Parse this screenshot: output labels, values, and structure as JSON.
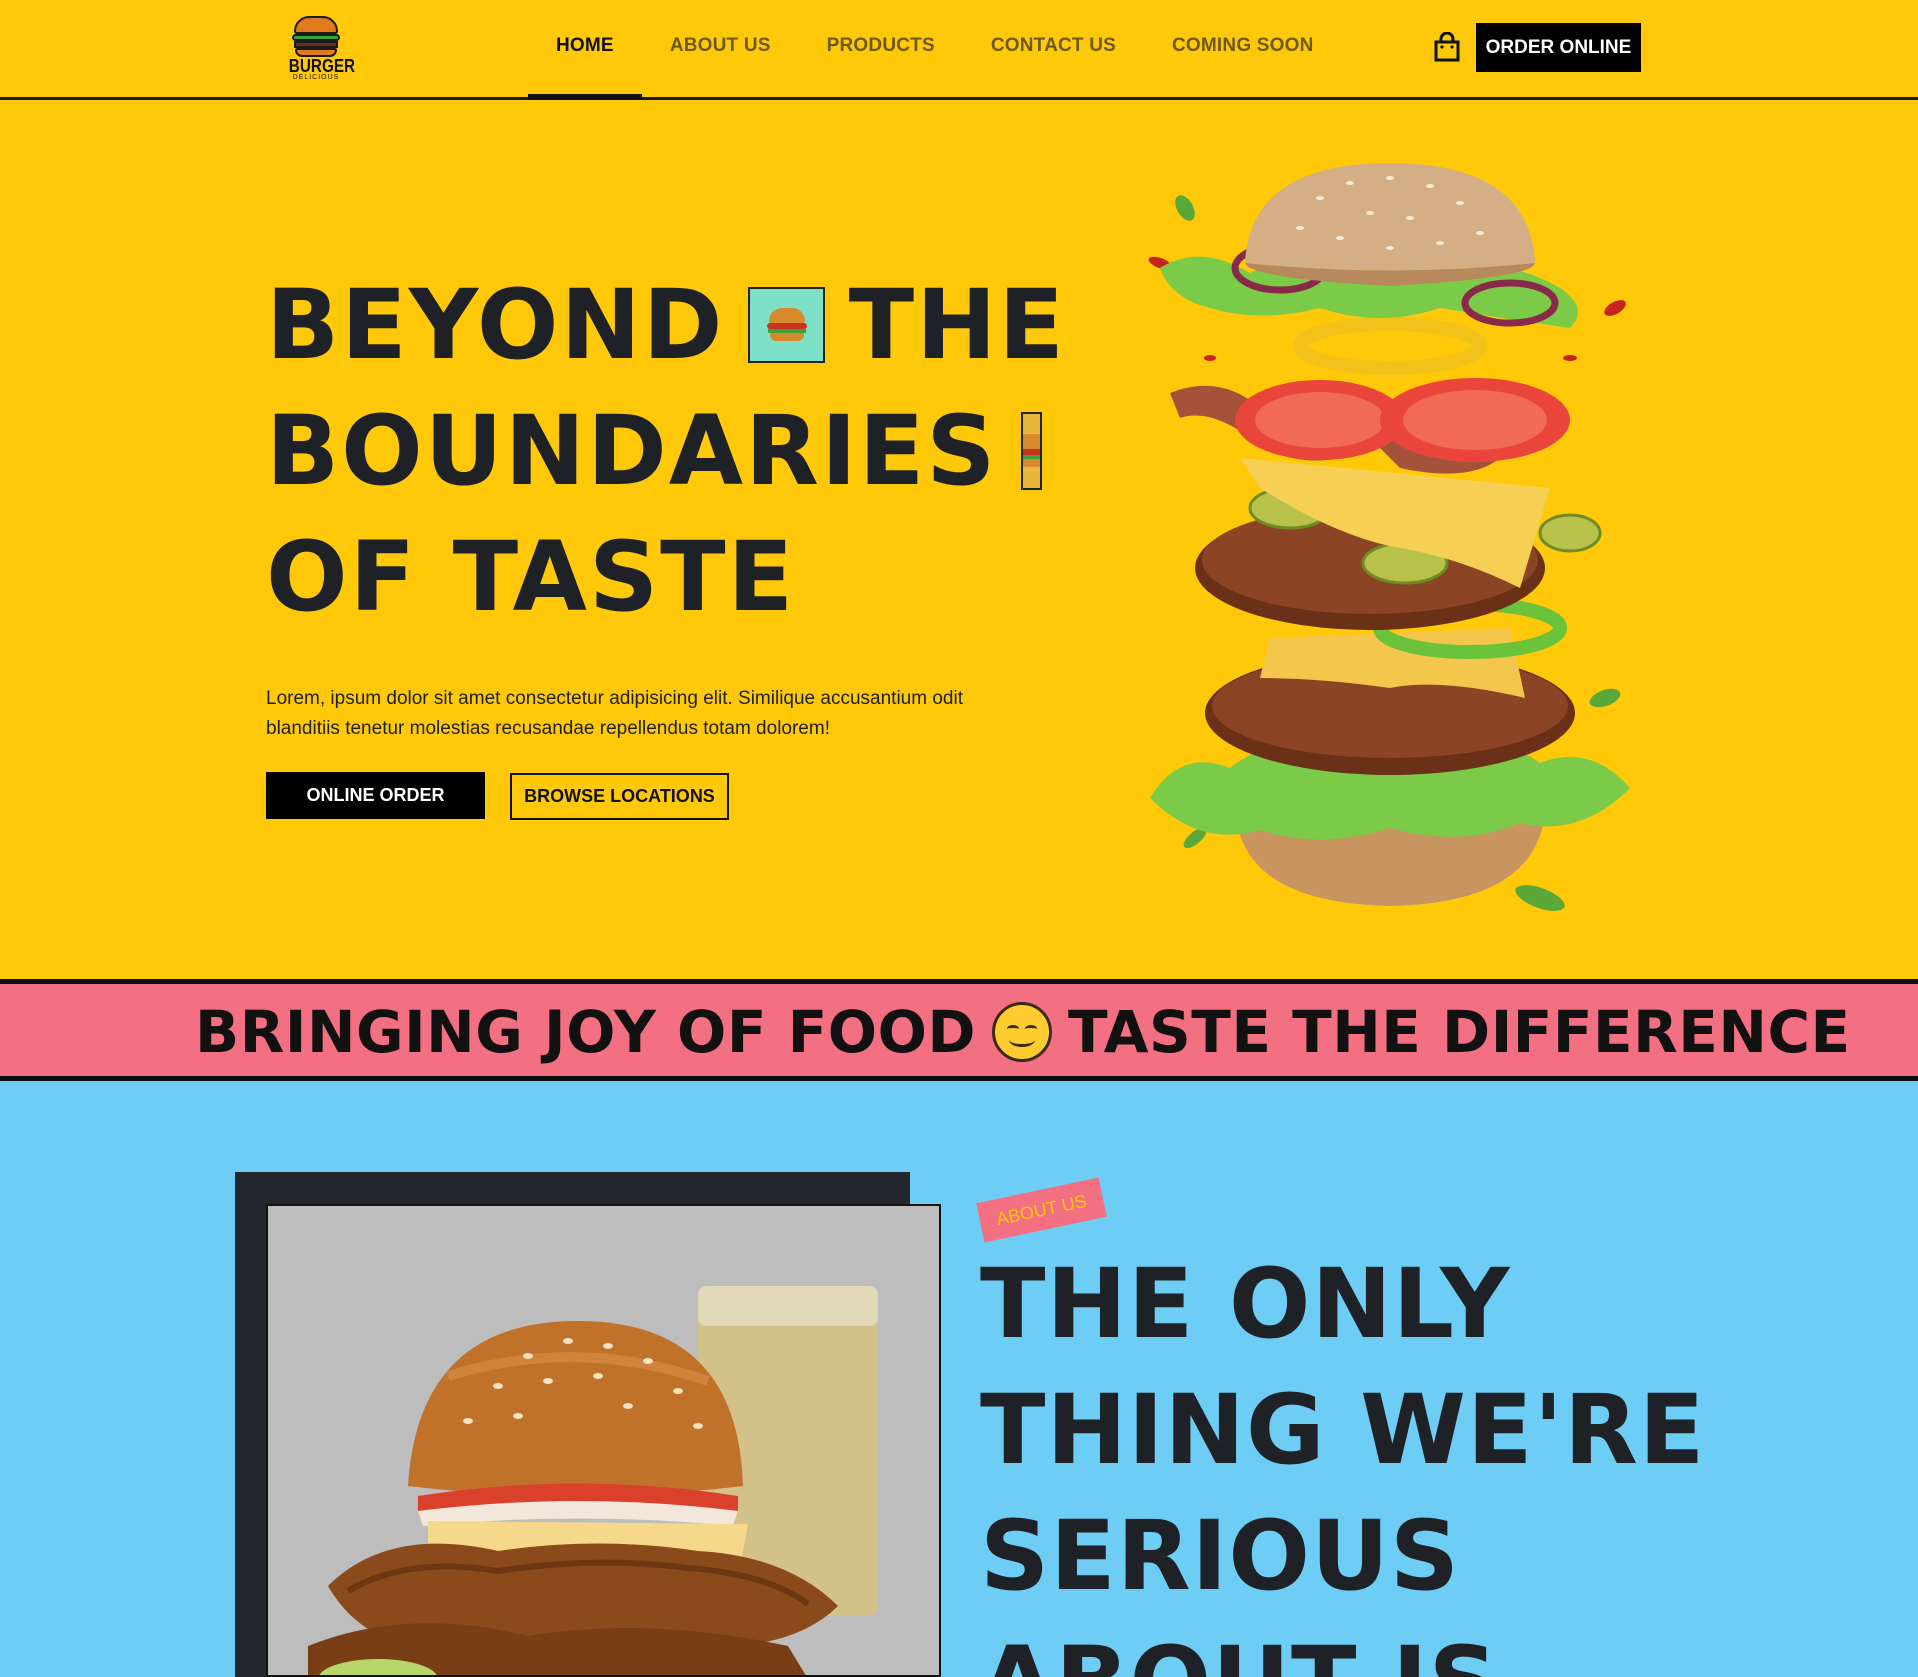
{
  "header": {
    "logo": {
      "title": "BURGER",
      "subtitle": "DELICIOUS"
    },
    "nav": [
      {
        "label": "HOME",
        "active": true
      },
      {
        "label": "ABOUT US",
        "active": false
      },
      {
        "label": "PRODUCTS",
        "active": false
      },
      {
        "label": "CONTACT US",
        "active": false
      },
      {
        "label": "COMING SOON",
        "active": false
      }
    ],
    "cart_icon": "shopping-bag-icon",
    "order_button": "ORDER ONLINE"
  },
  "hero": {
    "title_lines": [
      "BEYOND",
      "THE",
      "BOUNDARIES",
      "OF TASTE"
    ],
    "description": "Lorem, ipsum dolor sit amet consectetur adipisicing elit. Similique accusantium odit blanditiis tenetur molestias recusandae repellendus totam dolorem!",
    "primary_button": "ONLINE ORDER",
    "secondary_button": "BROWSE LOCATIONS"
  },
  "band": {
    "text_left": "BRINGING JOY OF FOOD",
    "icon": "smiley-face-icon",
    "text_right": "TASTE THE DIFFERENCE"
  },
  "about": {
    "badge": "ABOUT US",
    "title_lines": [
      "THE ONLY",
      "THING WE'RE",
      "SERIOUS",
      "ABOUT IS"
    ]
  },
  "colors": {
    "hero_background": "#ffc909",
    "band_background": "#f36f82",
    "about_background": "#6ecdf4",
    "text_dark": "#1e2126"
  }
}
